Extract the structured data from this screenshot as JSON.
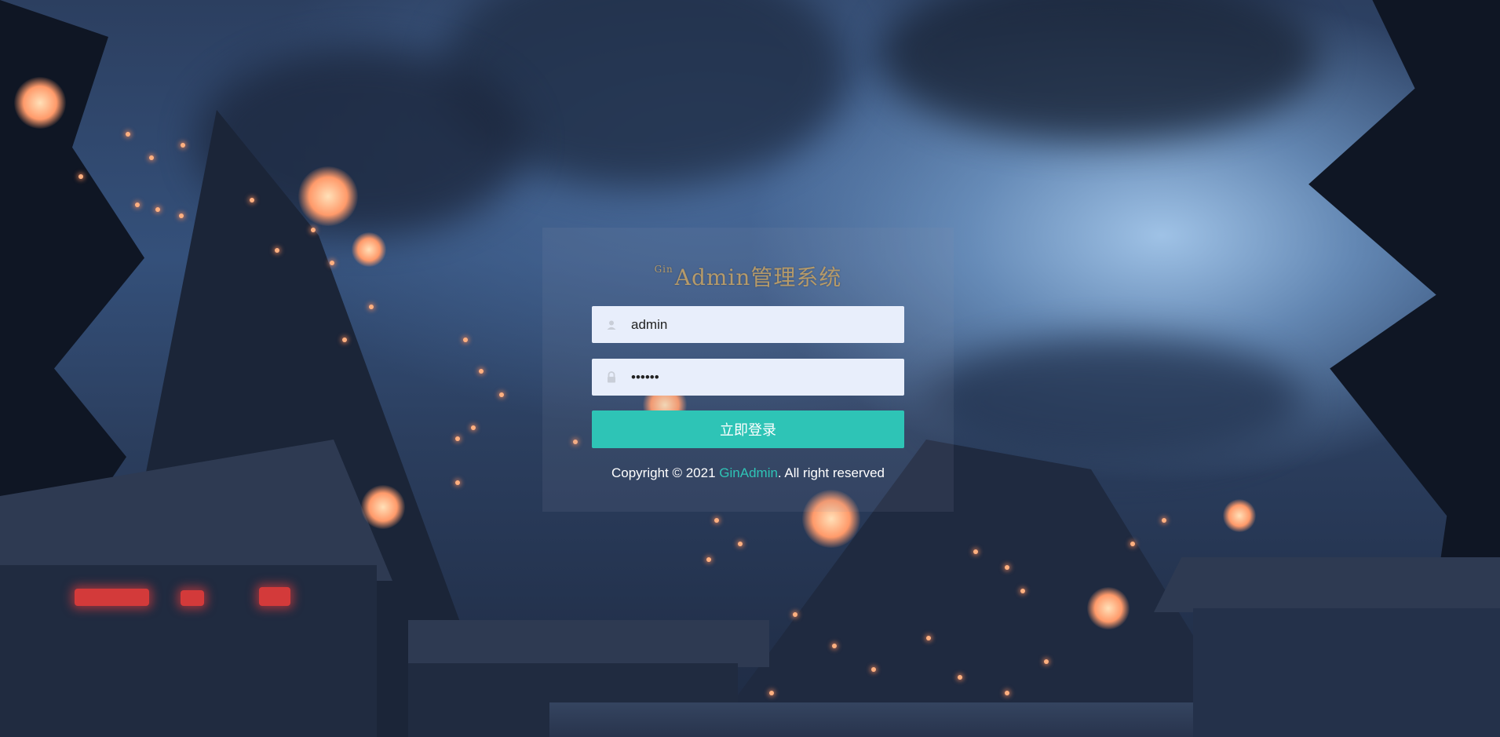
{
  "login": {
    "title_sup": "Gin",
    "title_main": "Admin管理系统",
    "username_value": "admin",
    "password_value": "••••••",
    "submit_label": "立即登录",
    "copyright_prefix": "Copyright © 2021 ",
    "copyright_brand": "GinAdmin",
    "copyright_suffix": ". All right reserved"
  },
  "icons": {
    "username": "user-icon",
    "password": "lock-icon"
  },
  "colors": {
    "accent": "#2ec4b6",
    "title": "#b59a6a",
    "input_bg": "#e8eefb"
  }
}
